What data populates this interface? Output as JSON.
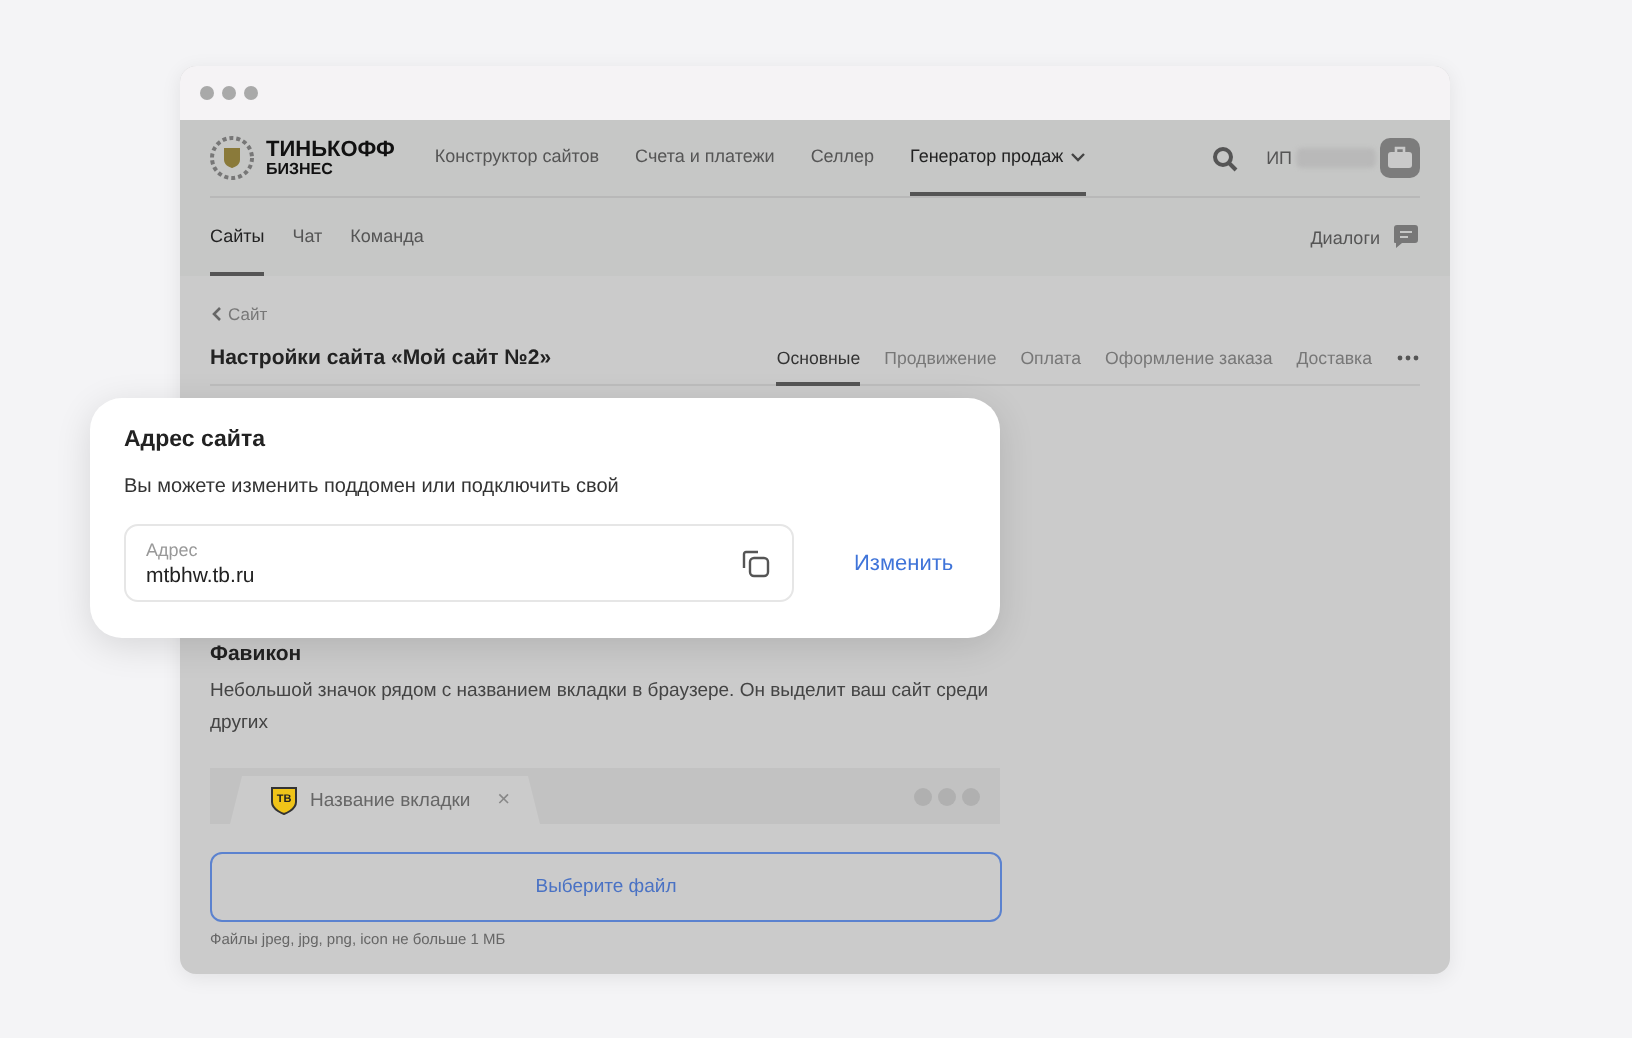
{
  "logo": {
    "line_1": "ТИНЬКОФФ",
    "line_2": "БИЗНЕС"
  },
  "nav": [
    {
      "label": "Конструктор сайтов",
      "selected": false,
      "dropdown": false
    },
    {
      "label": "Счета и платежи",
      "selected": false,
      "dropdown": false
    },
    {
      "label": "Селлер",
      "selected": false,
      "dropdown": false
    },
    {
      "label": "Генератор продаж",
      "selected": true,
      "dropdown": true
    }
  ],
  "user": {
    "label": "ИП"
  },
  "subnav": [
    {
      "label": "Сайты",
      "selected": true
    },
    {
      "label": "Чат",
      "selected": false
    },
    {
      "label": "Команда",
      "selected": false
    }
  ],
  "dialogs": {
    "label": "Диалоги"
  },
  "breadcrumb": "Сайт",
  "page_title": "Настройки сайта «Мой сайт №2»",
  "tabs": [
    {
      "label": "Основные",
      "selected": true
    },
    {
      "label": "Продвижение",
      "selected": false
    },
    {
      "label": "Оплата",
      "selected": false
    },
    {
      "label": "Оформление заказа",
      "selected": false
    },
    {
      "label": "Доставка",
      "selected": false
    }
  ],
  "popup": {
    "title": "Адрес сайта",
    "description": "Вы можете изменить поддомен или подключить свой",
    "field": {
      "label": "Адрес",
      "value": "mtbhw.tb.ru"
    },
    "action": "Изменить"
  },
  "favicon": {
    "title": "Фавикон",
    "description": "Небольшой значок рядом с названием вкладки в браузере. Он выделит ваш сайт среди других",
    "preview": {
      "badge": "TB",
      "tab_label": "Название вкладки",
      "close": "×"
    },
    "upload_button": "Выберите файл",
    "hint": "Файлы jpeg, jpg, png, icon не больше 1 МБ"
  }
}
